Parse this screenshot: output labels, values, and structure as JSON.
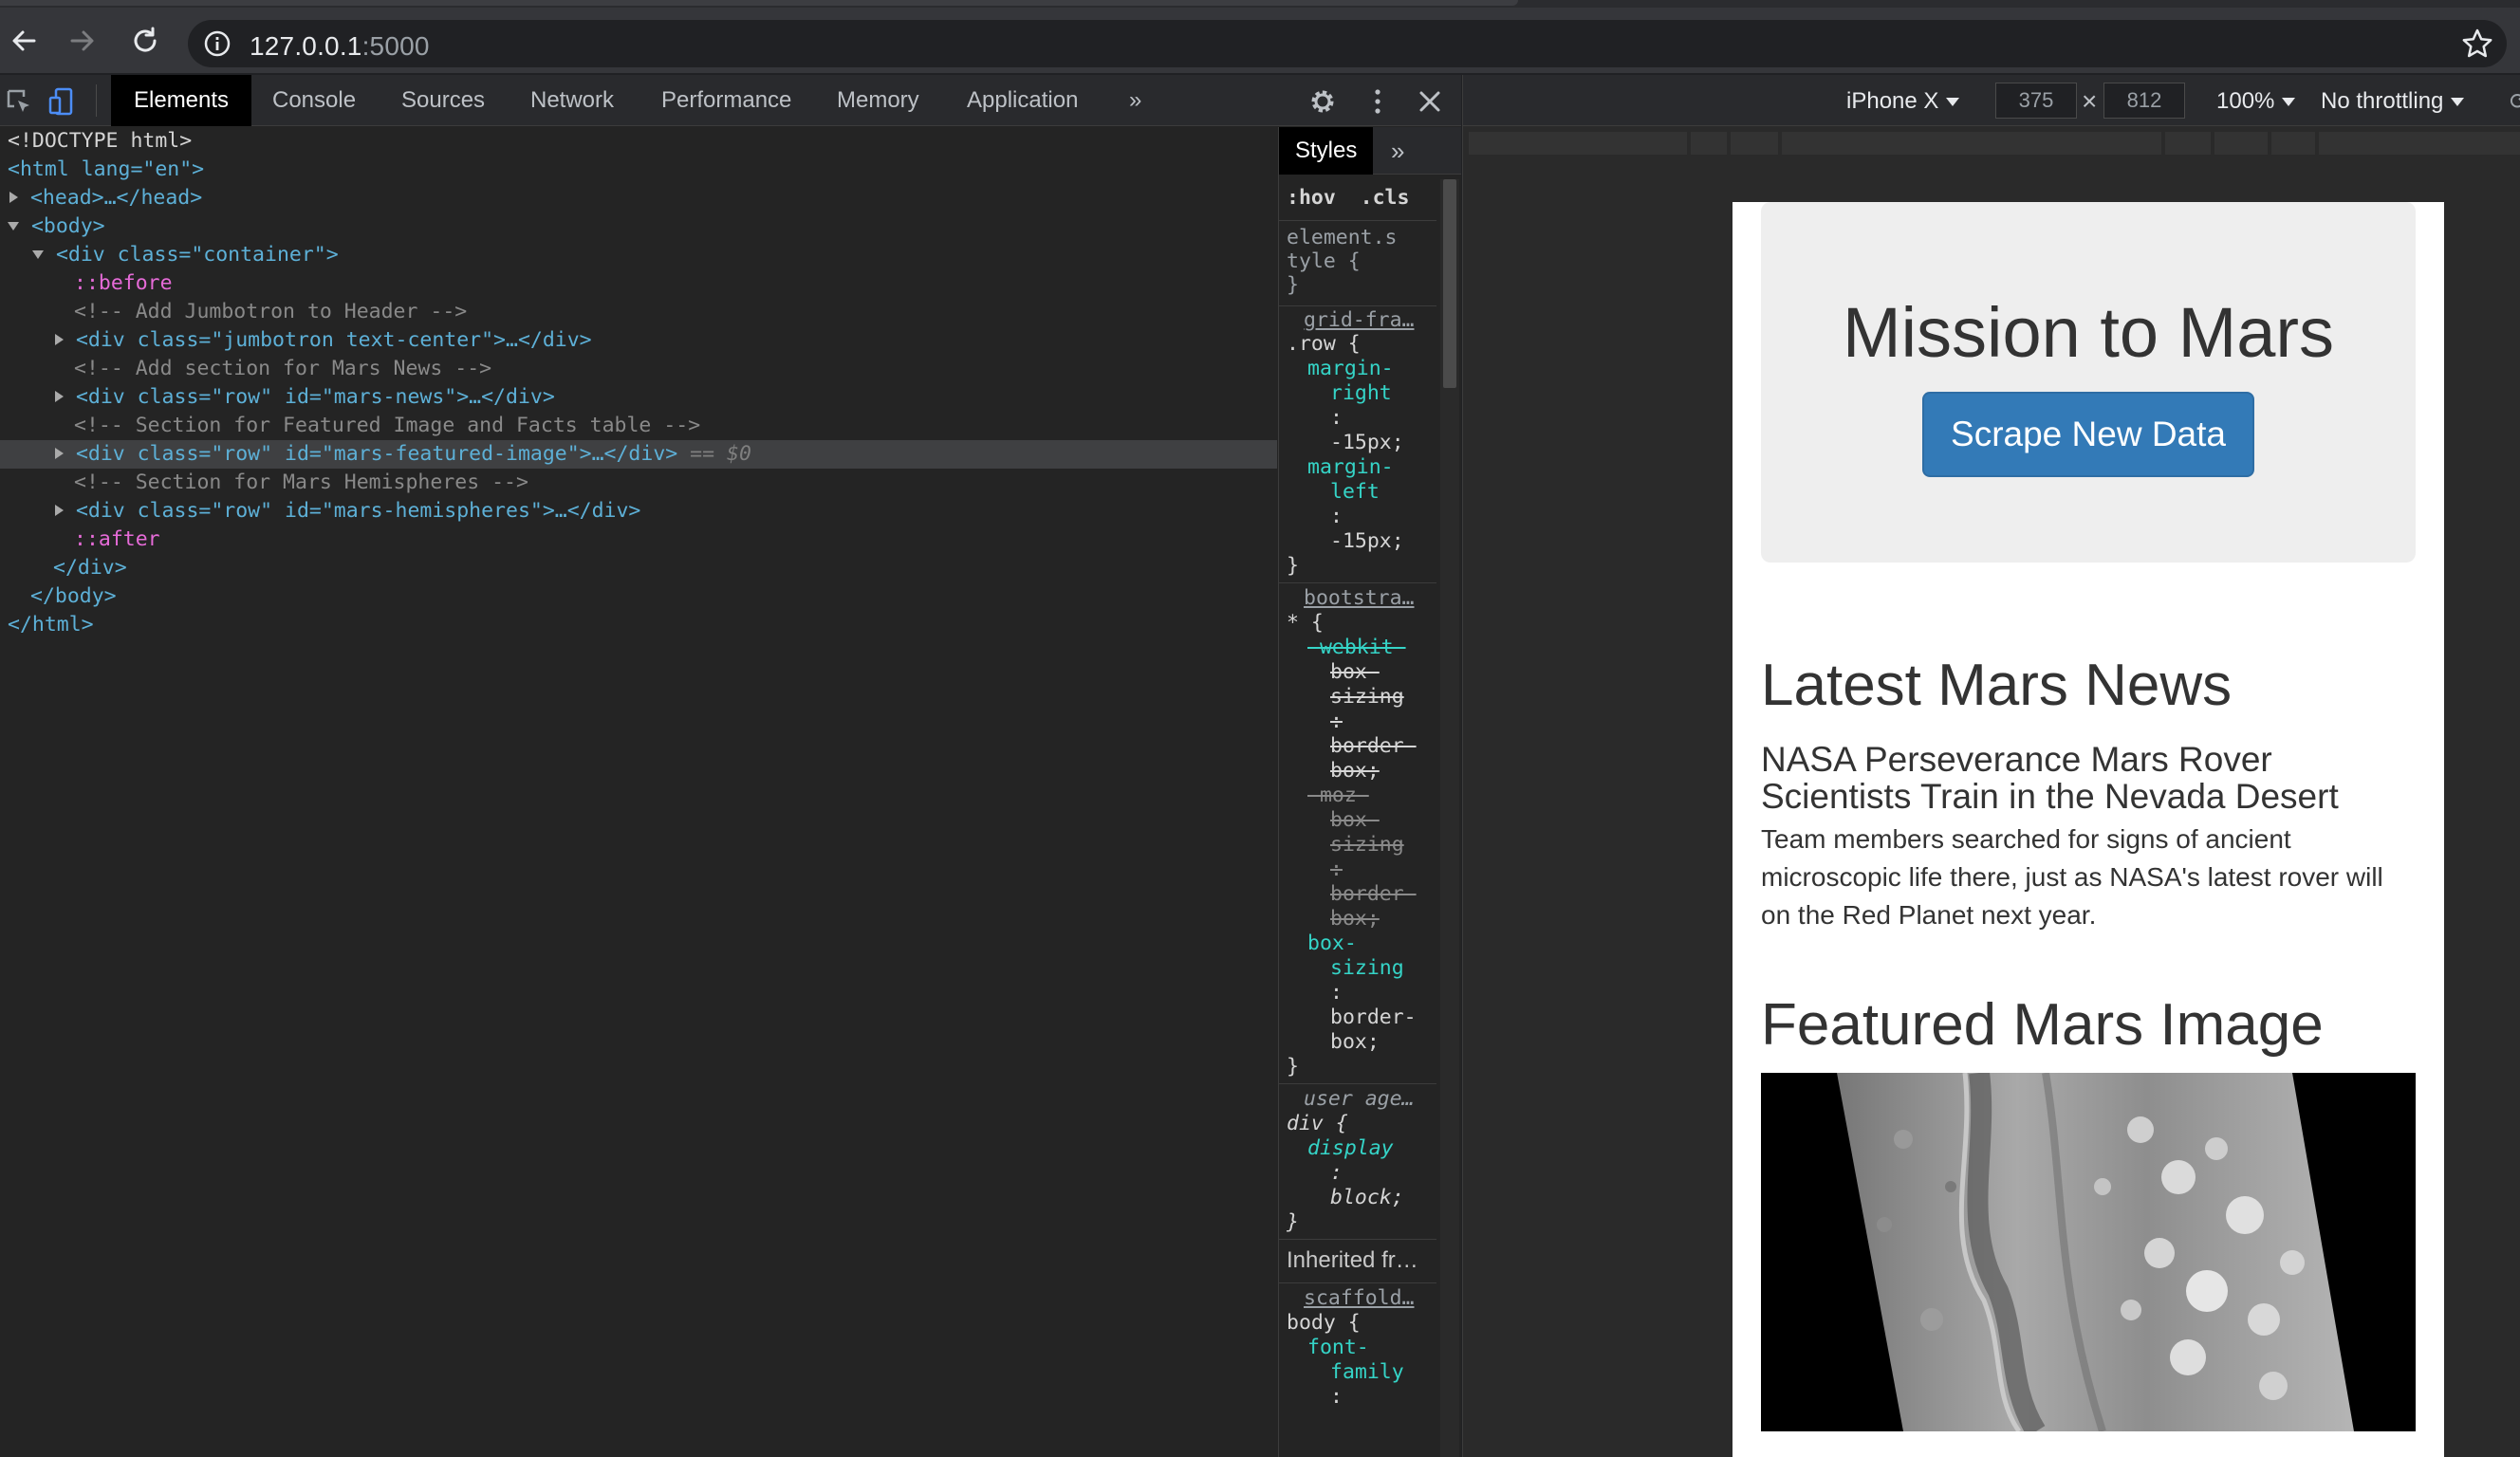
{
  "browser": {
    "url_host": "127.0.0.1",
    "url_port": ":5000"
  },
  "devtools": {
    "tabs": [
      "Elements",
      "Console",
      "Sources",
      "Network",
      "Performance",
      "Memory",
      "Application"
    ],
    "more_tabs": "»",
    "elements_tree": [
      "<!DOCTYPE html>",
      "<html lang=\"en\">",
      "<head>…</head>",
      "<body>",
      "<div class=\"container\">",
      "::before",
      "<!-- Add Jumbotron to Header -->",
      "<div class=\"jumbotron text-center\">…</div>",
      "<!-- Add section for Mars News -->",
      "<div class=\"row\" id=\"mars-news\">…</div>",
      "<!-- Section for Featured Image and Facts table -->",
      "<div class=\"row\" id=\"mars-featured-image\">…</div>",
      "== $0",
      "<!-- Section for Mars Hemispheres -->",
      "<div class=\"row\" id=\"mars-hemispheres\">…</div>",
      "::after",
      "</div>",
      "</body>",
      "</html>"
    ],
    "styles": {
      "tab": "Styles",
      "more": "»",
      "hov": ":hov",
      "cls": ".cls",
      "element_style_1": "element.s",
      "element_style_2": "tyle {",
      "close": "}",
      "src_grid": "grid-fra…",
      "sel_row": ".row {",
      "p_margin_right_1": "margin-",
      "p_margin_right_2": "right",
      "colon": ":",
      "v_neg15": "-15px;",
      "p_margin_left_1": "margin-",
      "p_margin_left_2": "left",
      "src_bootstrap": "bootstra…",
      "sel_star": "* {",
      "webkit_1": "-webkit-",
      "webkit_2": "box-",
      "webkit_3": "sizing",
      "webkit_4": ":",
      "webkit_5": "border-",
      "webkit_6": "box;",
      "moz_1": "-moz-",
      "p_box_1": "box-",
      "p_box_2": "sizing",
      "v_border": "border-",
      "v_box": "box;",
      "src_ua": "user age…",
      "sel_div": "div {",
      "p_display": "display",
      "v_block": "block;",
      "inherited": "Inherited fr…",
      "src_scaffold": "scaffold…",
      "sel_body": "body {",
      "p_font_1": "font-",
      "p_font_2": "family"
    }
  },
  "device_toolbar": {
    "device": "iPhone X",
    "width": "375",
    "times": "×",
    "height": "812",
    "zoom": "100%",
    "throttling": "No throttling"
  },
  "page": {
    "jumbotron_title": "Mission to Mars",
    "scrape_button": "Scrape New Data",
    "news_section_title": "Latest Mars News",
    "news_headline": "NASA Perseverance Mars Rover Scientists Train in the Nevada Desert",
    "news_body": "Team members searched for signs of ancient microscopic life there, just as NASA's latest rover will on the Red Planet next year.",
    "featured_title": "Featured Mars Image"
  }
}
